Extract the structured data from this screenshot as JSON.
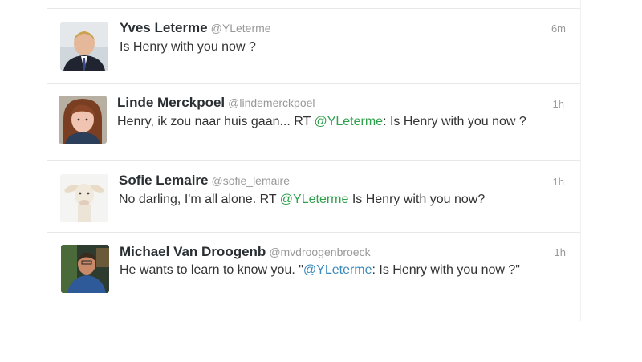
{
  "tweets": [
    {
      "name": "Yves Leterme",
      "handle": "@YLeterme",
      "time": "6m",
      "text": "Is Henry with you now ?",
      "avatar_icon": "man-portrait-avatar"
    },
    {
      "name": "Linde Merckpoel",
      "handle": "@lindemerckpoel",
      "time": "1h",
      "text_before": "Henry, ik zou naar huis gaan... RT ",
      "mention": "@YLeterme",
      "text_after": ": Is Henry with you now ?",
      "avatar_icon": "woman-portrait-avatar"
    },
    {
      "name": "Sofie Lemaire",
      "handle": "@sofie_lemaire",
      "time": "1h",
      "text_before": "No darling, I'm all alone. RT ",
      "mention": "@YLeterme",
      "text_after": " Is Henry with you now?",
      "avatar_icon": "lamb-avatar"
    },
    {
      "name": "Michael Van Droogenb",
      "handle": "@mvdroogenbroeck",
      "time": "1h",
      "text_before": "He wants to learn to know you. \"",
      "mention": "@YLeterme",
      "text_after": ": Is Henry with you now ?\"",
      "avatar_icon": "man-tv-avatar"
    }
  ],
  "colors": {
    "mention_green": "#2fa14d",
    "mention_blue": "#3b8bbf",
    "name": "#292f33",
    "meta": "#999999"
  }
}
